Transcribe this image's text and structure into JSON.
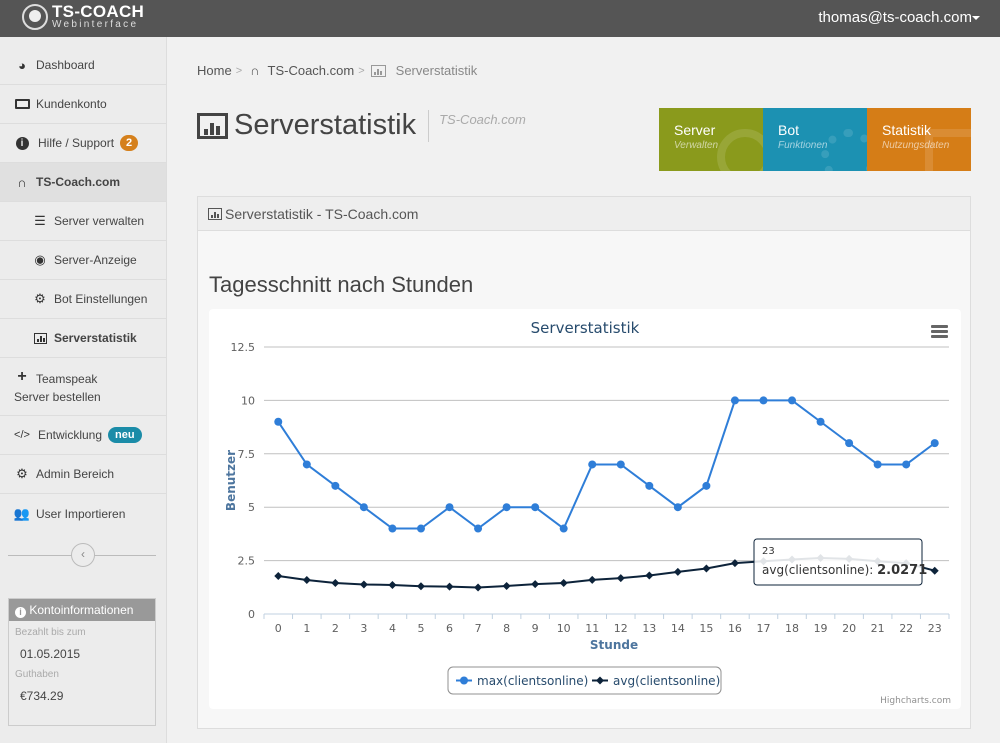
{
  "header": {
    "logo_title": "TS-COACH",
    "logo_subtitle": "Webinterface",
    "user_email": "thomas@ts-coach.com"
  },
  "sidebar": {
    "items": [
      {
        "label": "Dashboard",
        "icon": "dashboard-icon"
      },
      {
        "label": "Kundenkonto",
        "icon": "money-icon"
      },
      {
        "label": "Hilfe / Support",
        "icon": "info-icon",
        "badge": "2"
      },
      {
        "label": "TS-Coach.com",
        "icon": "headphones-icon"
      },
      {
        "label": "Server verwalten",
        "icon": "list-icon"
      },
      {
        "label": "Server-Anzeige",
        "icon": "eye-icon"
      },
      {
        "label": "Bot Einstellungen",
        "icon": "gears-icon"
      },
      {
        "label": "Serverstatistik",
        "icon": "bar-chart-icon"
      },
      {
        "label": "Teamspeak Server bestellen",
        "icon": "plus-icon"
      },
      {
        "label": "Entwicklung",
        "icon": "code-icon",
        "badge": "neu"
      },
      {
        "label": "Admin Bereich",
        "icon": "gears-icon"
      },
      {
        "label": "User Importieren",
        "icon": "users-icon"
      }
    ],
    "account": {
      "title": "Kontoinformationen",
      "paid_until_label": "Bezahlt bis zum",
      "paid_until": "01.05.2015",
      "balance_label": "Guthaben",
      "balance": "€734.29"
    }
  },
  "breadcrumb": {
    "home": "Home",
    "section": "TS-Coach.com",
    "current": "Serverstatistik",
    "sep": ">"
  },
  "page": {
    "title": "Serverstatistik",
    "subtitle": "TS-Coach.com"
  },
  "tiles": [
    {
      "title": "Server",
      "subtitle": "Verwalten",
      "color": "#8a9a1c"
    },
    {
      "title": "Bot",
      "subtitle": "Funktionen",
      "color": "#1c91b2"
    },
    {
      "title": "Statistik",
      "subtitle": "Nutzungsdaten",
      "color": "#d57d17"
    }
  ],
  "panel": {
    "heading": "Serverstatistik - TS-Coach.com",
    "section_title": "Tagesschnitt nach Stunden"
  },
  "chart_data": {
    "type": "line",
    "title": "Serverstatistik",
    "xlabel": "Stunde",
    "ylabel": "Benutzer",
    "x": [
      0,
      1,
      2,
      3,
      4,
      5,
      6,
      7,
      8,
      9,
      10,
      11,
      12,
      13,
      14,
      15,
      16,
      17,
      18,
      19,
      20,
      21,
      22,
      23
    ],
    "yticks": [
      0,
      2.5,
      5,
      7.5,
      10,
      12.5
    ],
    "ylim": [
      0,
      12.5
    ],
    "grid": true,
    "legend": "bottom-center",
    "series": [
      {
        "name": "max(clientsonline)",
        "color": "#2f7ed8",
        "marker": "circle",
        "values": [
          9,
          7,
          6,
          5,
          4,
          4,
          5,
          4,
          5,
          5,
          4,
          7,
          7,
          6,
          5,
          6,
          10,
          10,
          10,
          9,
          8,
          7,
          7,
          8
        ]
      },
      {
        "name": "avg(clientsonline)",
        "color": "#0d233a",
        "marker": "diamond",
        "values": [
          1.78,
          1.59,
          1.45,
          1.38,
          1.36,
          1.3,
          1.28,
          1.24,
          1.31,
          1.4,
          1.45,
          1.6,
          1.68,
          1.8,
          1.97,
          2.13,
          2.38,
          2.47,
          2.55,
          2.62,
          2.58,
          2.47,
          2.38,
          2.0271
        ]
      }
    ],
    "tooltip": {
      "x": "23",
      "series": "avg(clientsonline)",
      "value": "2.0271"
    },
    "credits": "Highcharts.com",
    "menu_icon": "hamburger-menu-icon"
  }
}
